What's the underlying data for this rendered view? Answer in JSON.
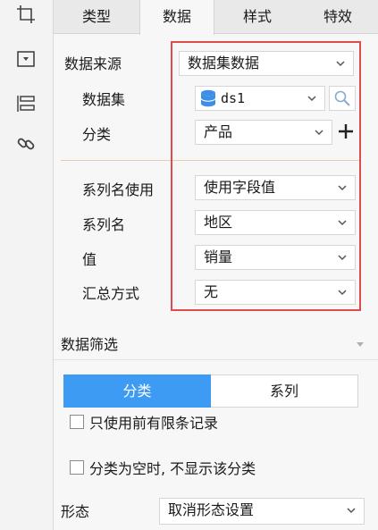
{
  "rail": {
    "icons": [
      "crop-frame-icon",
      "dropdown-box-icon",
      "layout-panel-icon",
      "link-icon"
    ]
  },
  "tabs": [
    {
      "label": "类型",
      "active": false
    },
    {
      "label": "数据",
      "active": true
    },
    {
      "label": "样式",
      "active": false
    },
    {
      "label": "特效",
      "active": false
    }
  ],
  "data_source": {
    "label": "数据来源",
    "value": "数据集数据"
  },
  "dataset": {
    "label": "数据集",
    "value": "ds1"
  },
  "category": {
    "label": "分类",
    "value": "产品"
  },
  "series_name_use": {
    "label": "系列名使用",
    "value": "使用字段值"
  },
  "series_name": {
    "label": "系列名",
    "value": "地区"
  },
  "value_field": {
    "label": "值",
    "value": "销量"
  },
  "aggregation": {
    "label": "汇总方式",
    "value": "无"
  },
  "filter": {
    "title": "数据筛选",
    "segments": [
      {
        "label": "分类",
        "active": true
      },
      {
        "label": "系列",
        "active": false
      }
    ],
    "only_top_records": "只使用前有限条记录",
    "hide_empty_category": "分类为空时, 不显示该分类"
  },
  "shape": {
    "label": "形态",
    "value": "取消形态设置"
  },
  "colors": {
    "accent": "#3d9bf4",
    "highlight": "#e04b4b",
    "db_icon": "#3d8fe6"
  }
}
